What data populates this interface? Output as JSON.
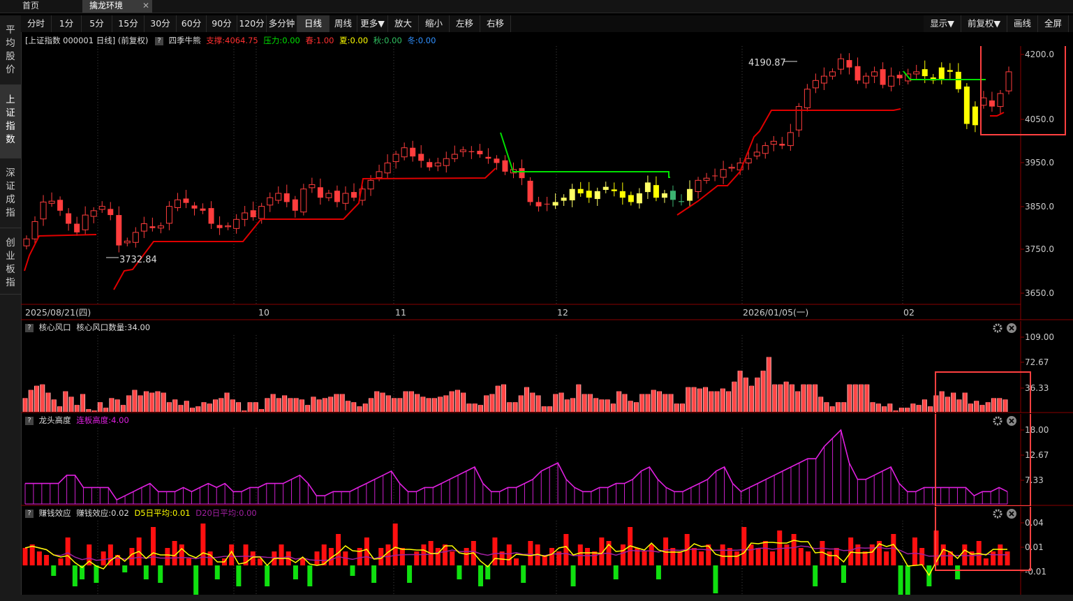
{
  "tabs": {
    "home": "首页",
    "active": "擒龙环境",
    "close": "✕"
  },
  "sidebar": [
    {
      "label": "平均股价",
      "active": false
    },
    {
      "label": "上证指数",
      "active": true
    },
    {
      "label": "深证成指",
      "active": false
    },
    {
      "label": "创业板指",
      "active": false
    }
  ],
  "toolbar_left": [
    "分时",
    "1分",
    "5分",
    "15分",
    "30分",
    "60分",
    "90分",
    "120分",
    "多分钟",
    "日线",
    "周线",
    "更多▼",
    "放大",
    "缩小",
    "左移",
    "右移"
  ],
  "toolbar_active": "日线",
  "toolbar_right": [
    "显示▼",
    "前复权▼",
    "画线",
    "全屏"
  ],
  "info": {
    "title": "[上证指数 000001 日线] (前复权)",
    "indicator": "四季牛熊",
    "support": "支撑:4064.75",
    "pressure": "压力:0.00",
    "spring": "春:1.00",
    "summer": "夏:0.00",
    "autumn": "秋:0.00",
    "winter": "冬:0.00"
  },
  "colors": {
    "up": "#ff3d3d",
    "down_yellow": "#ffff00",
    "green_line": "#00e600",
    "support_red": "#e00000",
    "magenta": "#e020e0",
    "highlight_box": "#ff4040"
  },
  "main_chart": {
    "y_ticks": [
      "4200.0",
      "4050.0",
      "3950.0",
      "3850.0",
      "3750.0",
      "3650.0"
    ],
    "x_labels": [
      "2025/08/21(四)",
      "10",
      "11",
      "12",
      "2026/01/05(一)",
      "02"
    ],
    "high_label": "4190.87",
    "low_label": "3732.84"
  },
  "panel_wind": {
    "name": "核心风口",
    "value_label": "核心风口数量:34.00",
    "y_ticks": [
      "109.00",
      "72.67",
      "36.33"
    ]
  },
  "panel_dragon": {
    "name": "龙头高度",
    "value_label": "连板高度:4.00",
    "y_ticks": [
      "18.00",
      "12.67",
      "7.33"
    ]
  },
  "panel_profit": {
    "name": "赚钱效应",
    "value_label": "赚钱效应:0.02",
    "d5_label": "D5日平均:0.01",
    "d20_label": "D20日平均:0.00",
    "y_ticks": [
      "0.04",
      "0.01",
      "-0.01"
    ]
  },
  "chart_data": {
    "type": "candlestick",
    "series_wind": [
      20,
      32,
      38,
      40,
      28,
      18,
      8,
      30,
      22,
      10,
      26,
      4,
      2,
      14,
      6,
      20,
      18,
      10,
      24,
      32,
      24,
      30,
      28,
      30,
      28,
      14,
      18,
      10,
      16,
      6,
      8,
      14,
      12,
      18,
      20,
      28,
      18,
      14,
      2,
      14,
      14,
      4,
      20,
      26,
      20,
      24,
      20,
      20,
      18,
      10,
      22,
      18,
      20,
      22,
      26,
      26,
      16,
      14,
      8,
      12,
      20,
      30,
      28,
      24,
      20,
      20,
      30,
      30,
      26,
      22,
      20,
      20,
      22,
      24,
      30,
      32,
      28,
      12,
      12,
      10,
      24,
      26,
      38,
      40,
      14,
      14,
      24,
      36,
      28,
      24,
      8,
      8,
      26,
      28,
      18,
      20,
      40,
      26,
      26,
      20,
      18,
      18,
      12,
      30,
      26,
      16,
      14,
      26,
      26,
      32,
      30,
      26,
      26,
      12,
      12,
      36,
      36,
      34,
      36,
      30,
      30,
      34,
      30,
      44,
      60,
      50,
      38,
      50,
      60,
      80,
      40,
      40,
      44,
      40,
      30,
      40,
      40,
      40,
      22,
      14,
      8,
      14,
      14,
      40,
      40,
      40,
      40,
      14,
      12,
      8,
      12,
      2,
      6,
      6,
      12,
      10,
      18,
      8,
      24,
      30,
      22,
      28,
      18,
      28,
      12,
      16,
      10,
      14,
      20,
      20,
      18
    ],
    "series_dragon": [
      5,
      5,
      5,
      5,
      5,
      7,
      7,
      4,
      4,
      4,
      4,
      1,
      2,
      3,
      4,
      5,
      3,
      3,
      3,
      4,
      3,
      4,
      5,
      4,
      5,
      3,
      3,
      4,
      4,
      5,
      5,
      5,
      6,
      7,
      5,
      2,
      2,
      3,
      3,
      3,
      4,
      5,
      6,
      7,
      8,
      5,
      3,
      3,
      4,
      4,
      5,
      6,
      7,
      8,
      9,
      5,
      3,
      3,
      4,
      4,
      5,
      6,
      8,
      9,
      10,
      6,
      4,
      3,
      3,
      4,
      4,
      5,
      5,
      6,
      8,
      9,
      6,
      4,
      3,
      3,
      4,
      5,
      6,
      8,
      9,
      5,
      3,
      4,
      5,
      6,
      7,
      8,
      9,
      10,
      11,
      11,
      14,
      16,
      18,
      10,
      6,
      6,
      7,
      8,
      9,
      5,
      3,
      3,
      4,
      4,
      4,
      4,
      4,
      4,
      2,
      3,
      3,
      4,
      3
    ],
    "series_profit": [
      0.005,
      0.006,
      0.004,
      0.003,
      -0.003,
      0.002,
      0.008,
      -0.006,
      -0.004,
      0.006,
      -0.005,
      0.004,
      0.006,
      0.003,
      -0.002,
      0.005,
      0.008,
      -0.004,
      0.011,
      -0.005,
      0.005,
      0.007,
      0.006,
      0.002,
      -0.009,
      0.012,
      0.004,
      -0.004,
      0.002,
      0.006,
      -0.006,
      0.006,
      0.004,
      0.002,
      -0.006,
      0.004,
      0.006,
      0.004,
      -0.004,
      0.002,
      -0.006,
      0.004,
      0.006,
      0.005,
      0.009,
      0.004,
      -0.003,
      0.005,
      0.008,
      -0.005,
      0.005,
      0.006,
      0.012,
      0.005,
      -0.005,
      0.004,
      0.006,
      0.007,
      0.005,
      0.006,
      0.004,
      -0.004,
      0.005,
      0.007,
      -0.006,
      -0.004,
      0.008,
      0.004,
      0.006,
      0.002,
      -0.005,
      0.007,
      0.006,
      0.003,
      0.005,
      0.004,
      0.009,
      -0.006,
      0.006,
      0.005,
      0.004,
      0.008,
      0.007,
      -0.004,
      0.006,
      0.011,
      0.005,
      0.004,
      0.006,
      -0.004,
      0.008,
      0.005,
      0.004,
      0.009,
      0.005,
      0.004,
      0.006,
      -0.008,
      0.006,
      0.005,
      0.004,
      0.011,
      0.006,
      0.005,
      0.007,
      0.004,
      0.01,
      0.006,
      0.009,
      0.005,
      0.004,
      -0.006,
      0.007,
      0.004,
      0.005,
      -0.005,
      0.008,
      0.006,
      0.004,
      0.006,
      0.007,
      0.004,
      0.009,
      -0.009,
      -0.012,
      0.008,
      0.005,
      -0.006,
      0.01,
      0.006,
      0.004,
      -0.004,
      0.006,
      0.004,
      0.007,
      0.002,
      0.004,
      0.006,
      0.004
    ]
  }
}
